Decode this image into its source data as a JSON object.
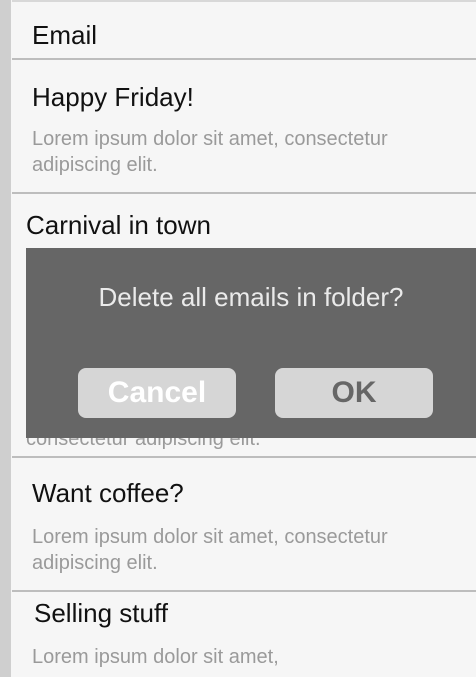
{
  "header": {
    "title": "Email"
  },
  "emails": [
    {
      "subject": "Happy Friday!",
      "preview": "Lorem ipsum dolor sit amet, consectetur adipiscing elit."
    },
    {
      "subject": "Carnival in town",
      "preview": "consectetur adipiscing elit."
    },
    {
      "subject": "Want coffee?",
      "preview": "Lorem ipsum dolor sit amet, consectetur adipiscing elit."
    },
    {
      "subject": "Selling stuff",
      "preview": "Lorem ipsum dolor sit amet,"
    }
  ],
  "dialog": {
    "message": "Delete all emails in folder?",
    "cancel_label": "Cancel",
    "ok_label": "OK"
  }
}
